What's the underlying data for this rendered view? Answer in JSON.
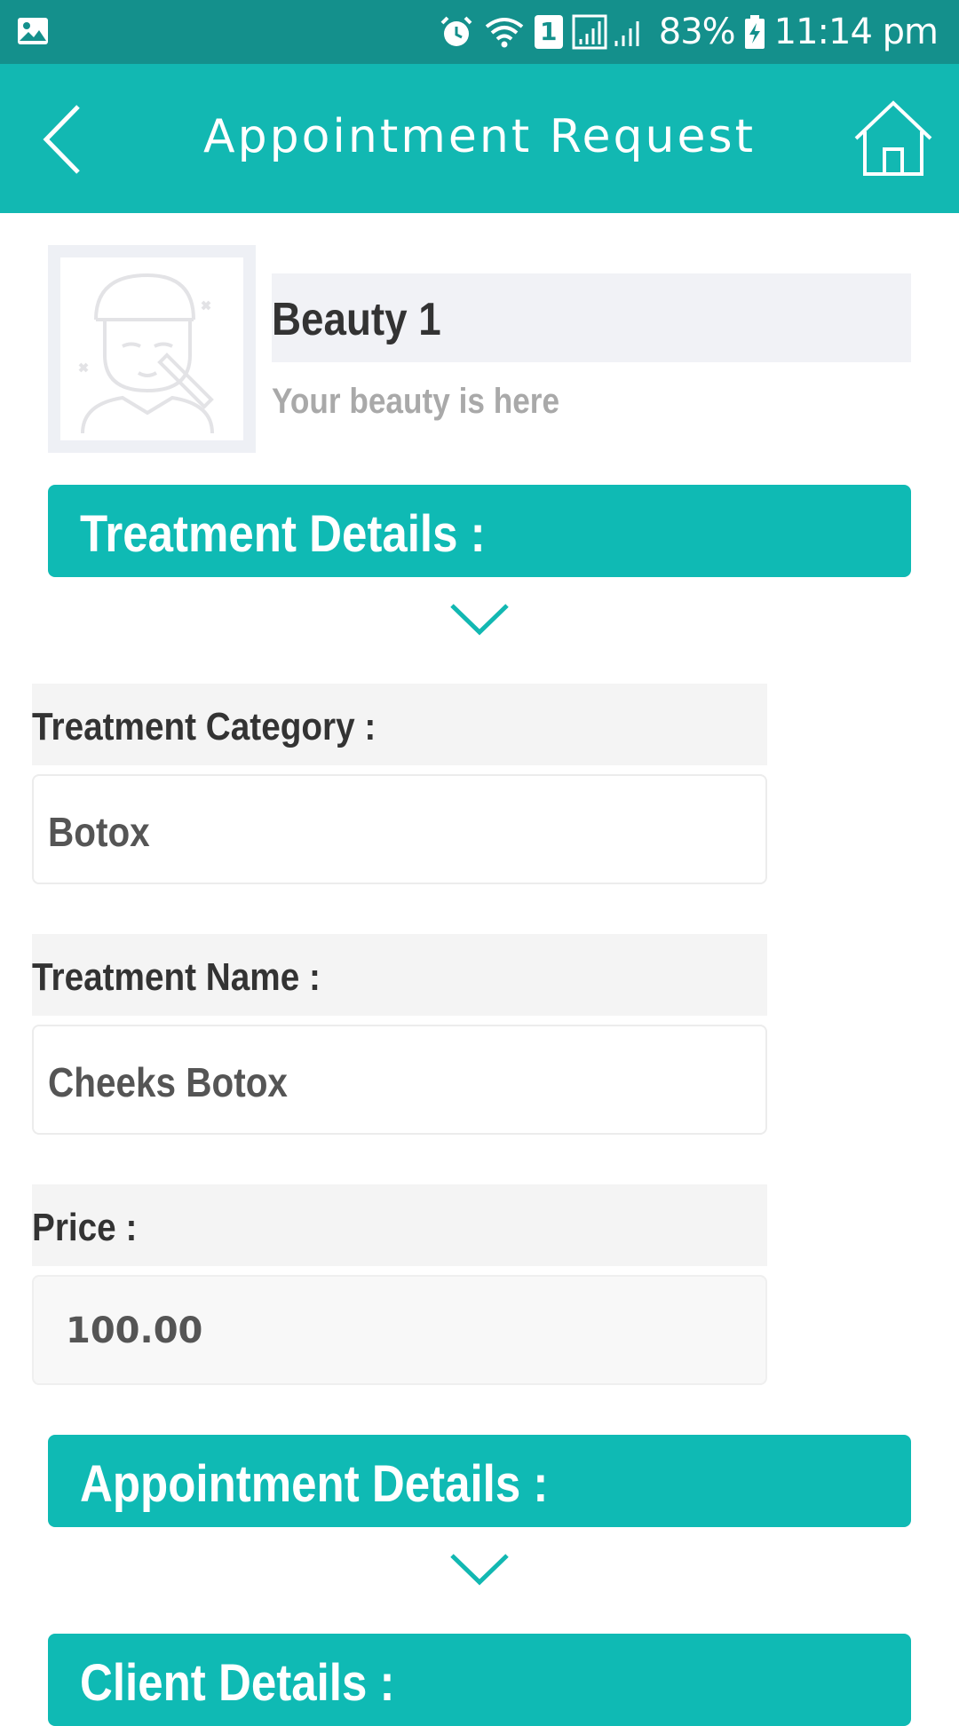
{
  "status_bar": {
    "battery": "83%",
    "time": "11:14 pm",
    "sim_badge": "1",
    "icons": [
      "image-icon",
      "alarm-icon",
      "wifi-icon",
      "sim-icon",
      "signal-icon",
      "battery-charging-icon"
    ]
  },
  "app_bar": {
    "title": "Appointment Request",
    "back_icon": "back-arrow-icon",
    "home_icon": "home-icon"
  },
  "profile": {
    "name": "Beauty 1",
    "tagline": "Your beauty is here",
    "avatar_icon": "beautician-avatar-icon"
  },
  "sections": {
    "treatment": "Treatment Details :",
    "appointment": "Appointment Details :",
    "client": "Client Details :"
  },
  "fields": {
    "category_label": "Treatment Category :",
    "category_value": "Botox",
    "name_label": "Treatment Name :",
    "name_value": "Cheeks Botox",
    "price_label": "Price :",
    "price_value": "100.00"
  },
  "colors": {
    "status_bar": "#14908c",
    "accent": "#12b8b2"
  }
}
